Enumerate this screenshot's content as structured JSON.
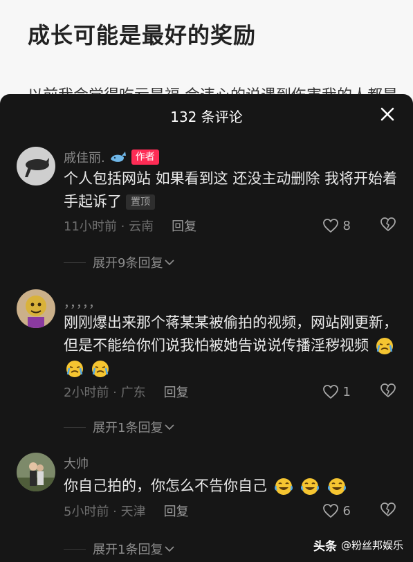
{
  "article": {
    "title": "成长可能是最好的奖励",
    "body_peek": "以前我会觉得吃亏是福 会违心的说遇到伤害我的人都是"
  },
  "sheet": {
    "title": "132 条评论",
    "close_icon": "close-icon"
  },
  "comments": [
    {
      "username": "戚佳丽.",
      "username_icon": "whale-icon",
      "author_badge": "作者",
      "text": "个人包括网站 如果看到这 还没主动删除 我将开始着手起诉了",
      "pinned": "置顶",
      "meta": "11小时前 · 云南",
      "reply": "回复",
      "likes": "8",
      "expand": "展开9条回复"
    },
    {
      "username": "，，，，，",
      "text": "刚刚爆出来那个蒋某某被偷拍的视频，网站刚更新，但是不能给你们说我怕被她告说说传播淫秽视频",
      "emoji_name": "crying-face-icon",
      "meta": "2小时前 · 广东",
      "reply": "回复",
      "likes": "1",
      "expand": "展开1条回复"
    },
    {
      "username": "大帅",
      "text": "你自己拍的，你怎么不告你自己",
      "emoji_name": "laughing-tears-icon",
      "meta": "5小时前 · 天津",
      "reply": "回复",
      "likes": "6",
      "expand": "展开1条回复"
    }
  ],
  "watermark": {
    "head": "头条",
    "account": "@粉丝邦娱乐"
  },
  "colors": {
    "sheet_bg": "#161616",
    "author_badge": "#fe2c55",
    "text": "#eaeaea",
    "meta": "#6e6e6e"
  }
}
